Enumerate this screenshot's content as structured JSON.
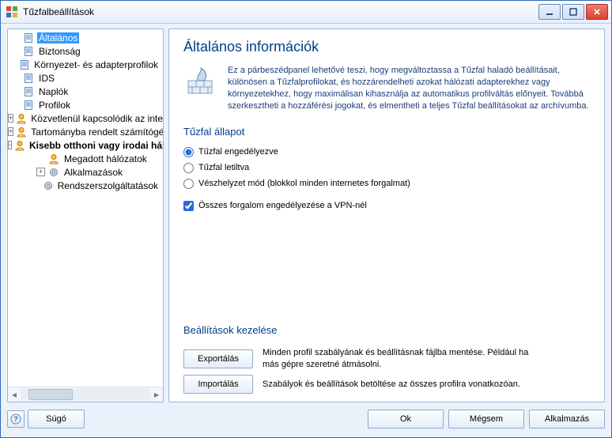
{
  "window": {
    "title": "Tűzfalbeállítások"
  },
  "tree": {
    "items": [
      {
        "label": "Általános",
        "depth": 0,
        "twisty": "",
        "icon": "page",
        "selected": true,
        "bold": false
      },
      {
        "label": "Biztonság",
        "depth": 0,
        "twisty": "",
        "icon": "page",
        "selected": false,
        "bold": false
      },
      {
        "label": "Környezet- és adapterprofilok",
        "depth": 0,
        "twisty": "",
        "icon": "page",
        "selected": false,
        "bold": false
      },
      {
        "label": "IDS",
        "depth": 0,
        "twisty": "",
        "icon": "page",
        "selected": false,
        "bold": false
      },
      {
        "label": "Naplók",
        "depth": 0,
        "twisty": "",
        "icon": "page",
        "selected": false,
        "bold": false
      },
      {
        "label": "Profilok",
        "depth": 0,
        "twisty": "",
        "icon": "page",
        "selected": false,
        "bold": false
      },
      {
        "label": "Közvetlenül kapcsolódik az internethez",
        "depth": 1,
        "twisty": "+",
        "icon": "user",
        "selected": false,
        "bold": false
      },
      {
        "label": "Tartományba rendelt számítógép",
        "depth": 1,
        "twisty": "+",
        "icon": "user",
        "selected": false,
        "bold": false
      },
      {
        "label": "Kisebb otthoni vagy irodai hálózat",
        "depth": 1,
        "twisty": "-",
        "icon": "user",
        "selected": false,
        "bold": true
      },
      {
        "label": "Megadott hálózatok",
        "depth": 2,
        "twisty": "",
        "icon": "user",
        "selected": false,
        "bold": false
      },
      {
        "label": "Alkalmazások",
        "depth": 2,
        "twisty": "+",
        "icon": "gear",
        "selected": false,
        "bold": false
      },
      {
        "label": "Rendszerszolgáltatások",
        "depth": 2,
        "twisty": "",
        "icon": "gear",
        "selected": false,
        "bold": false
      }
    ]
  },
  "page": {
    "title": "Általános információk",
    "intro": "Ez a párbeszédpanel lehetővé teszi, hogy megváltoztassa a Tűzfal haladó beállításait, különösen a Tűzfalprofilokat, és hozzárendelheti azokat hálózati adapterekhez vagy környezetekhez, hogy maximálisan kihasználja az automatikus profilváltás előnyeit. Továbbá szerkesztheti a hozzáférési jogokat, és elmentheti a teljes Tűzfal beállításokat az archívumba.",
    "status_head": "Tűzfal állapot",
    "radios": [
      {
        "label": "Tűzfal engedélyezve",
        "checked": true
      },
      {
        "label": "Tűzfal letiltva",
        "checked": false
      },
      {
        "label": "Vészhelyzet mód (blokkol minden internetes forgalmat)",
        "checked": false
      }
    ],
    "vpn_check": {
      "label": "Összes forgalom engedélyezése a VPN-nél",
      "checked": true
    },
    "mgmt_head": "Beállítások kezelése",
    "export": {
      "button": "Exportálás",
      "desc": "Minden profil szabályának és beállításnak fájlba mentése. Például ha más gépre szeretné átmásolni."
    },
    "import": {
      "button": "Importálás",
      "desc": "Szabályok és beállítások betöltése az összes profilra vonatkozóan."
    }
  },
  "footer": {
    "help": "Súgó",
    "ok": "Ok",
    "cancel": "Mégsem",
    "apply": "Alkalmazás"
  }
}
